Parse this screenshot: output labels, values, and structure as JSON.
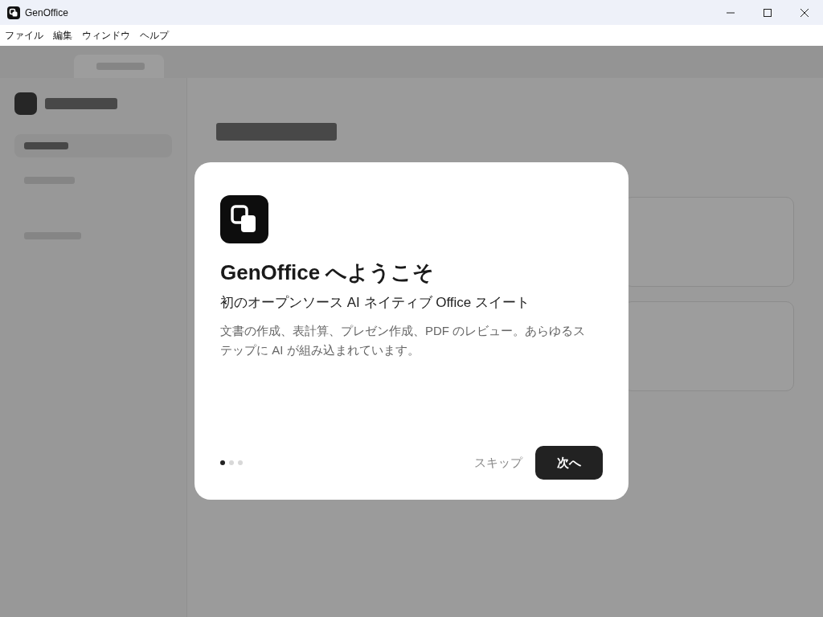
{
  "window": {
    "title": "GenOffice"
  },
  "menu": [
    "ファイル",
    "編集",
    "ウィンドウ",
    "ヘルプ"
  ],
  "sidebar": {
    "items": [
      {
        "selected": true
      },
      {
        "selected": false
      },
      {
        "selected": false
      }
    ]
  },
  "dialog": {
    "title": "GenOffice へようこそ",
    "subtitle": "初のオープンソース AI ネイティブ Office スイート",
    "body": "文書の作成、表計算、プレゼン作成、PDF のレビュー。あらゆるステップに AI が組み込まれています。",
    "steps": [
      {
        "selected": true
      },
      {
        "selected": false
      },
      {
        "selected": false
      }
    ],
    "skip": "スキップ",
    "next": "次へ"
  }
}
